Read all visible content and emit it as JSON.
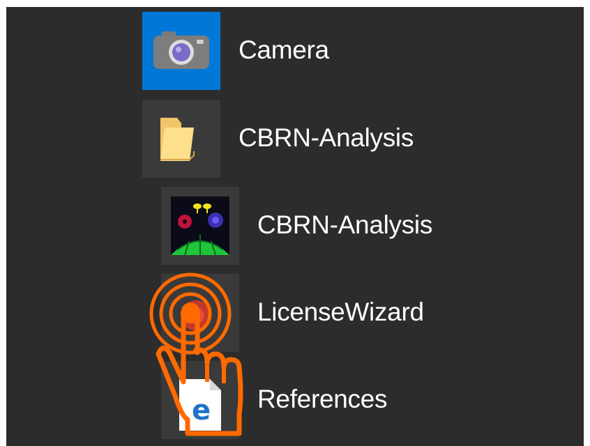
{
  "menu": {
    "items": [
      {
        "label": "Camera",
        "icon": "camera-icon",
        "tile_color": "#0078d7"
      },
      {
        "label": "CBRN-Analysis",
        "icon": "folder-icon",
        "tile_color": "#3a3a3a"
      },
      {
        "label": "CBRN-Analysis",
        "icon": "cbrn-analysis-app-icon",
        "tile_color": "#3a3a3a"
      },
      {
        "label": "LicenseWizard",
        "icon": "license-wizard-icon",
        "tile_color": "#3a3a3a"
      },
      {
        "label": "References",
        "icon": "edge-document-icon",
        "tile_color": "#3a3a3a"
      }
    ]
  },
  "overlay": {
    "icon": "tap-gesture-icon",
    "color": "#ff6a00"
  }
}
